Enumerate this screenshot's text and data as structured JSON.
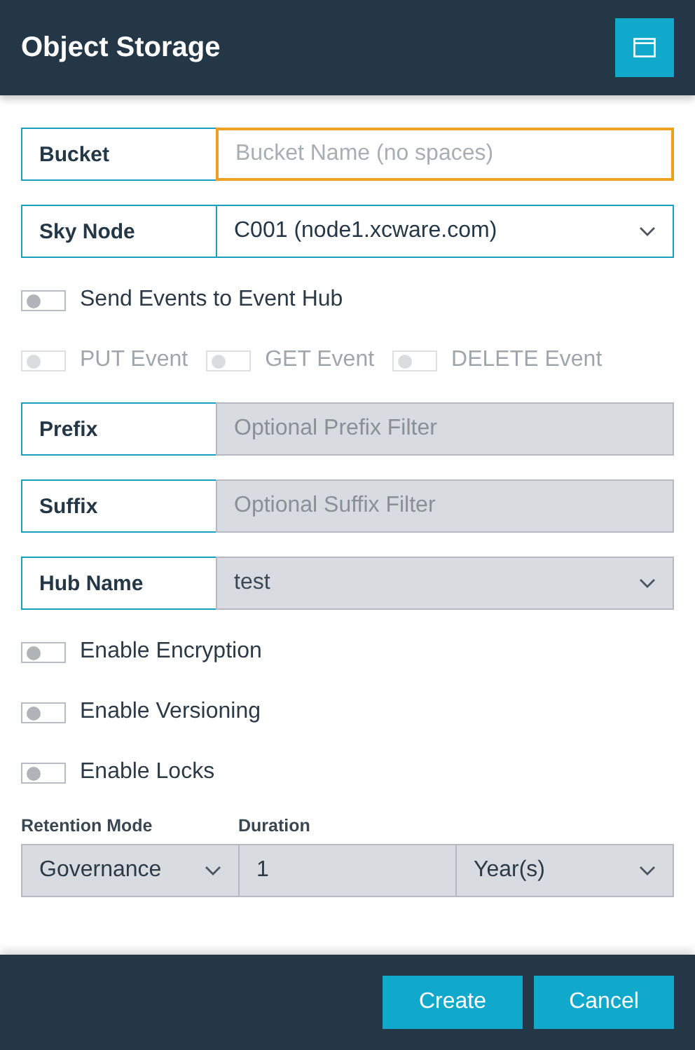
{
  "window": {
    "title": "Object Storage"
  },
  "rows": [
    {
      "kind": "text_field",
      "label": "Bucket",
      "placeholder": "Bucket Name (no spaces)",
      "focused": true,
      "disabled": false
    },
    {
      "kind": "select_field",
      "label": "Sky Node",
      "value": "C001 (node1.xcware.com)",
      "disabled": false
    },
    {
      "kind": "toggle",
      "label": "Send Events to Event Hub",
      "on": false,
      "disabled": false
    },
    {
      "kind": "toggle_group",
      "items": [
        {
          "label": "PUT Event",
          "on": false,
          "disabled": true
        },
        {
          "label": "GET Event",
          "on": false,
          "disabled": true
        },
        {
          "label": "DELETE Event",
          "on": false,
          "disabled": true
        }
      ]
    },
    {
      "kind": "text_field",
      "label": "Prefix",
      "placeholder": "Optional Prefix Filter",
      "focused": false,
      "disabled": true
    },
    {
      "kind": "text_field",
      "label": "Suffix",
      "placeholder": "Optional Suffix Filter",
      "focused": false,
      "disabled": true
    },
    {
      "kind": "select_field",
      "label": "Hub Name",
      "value": "test",
      "disabled": true
    },
    {
      "kind": "toggle",
      "label": "Enable Encryption",
      "on": false,
      "disabled": false
    },
    {
      "kind": "toggle",
      "label": "Enable Versioning",
      "on": false,
      "disabled": false
    },
    {
      "kind": "toggle",
      "label": "Enable Locks",
      "on": false,
      "disabled": false
    }
  ],
  "retention": {
    "mode_label": "Retention Mode",
    "duration_label": "Duration",
    "mode": "Governance",
    "duration": "1",
    "unit": "Year(s)",
    "disabled": true
  },
  "buttons": [
    {
      "label": "Create"
    },
    {
      "label": "Cancel"
    }
  ]
}
